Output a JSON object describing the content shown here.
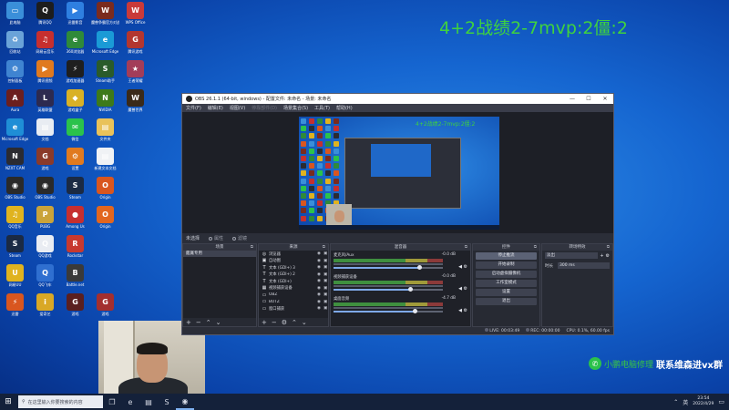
{
  "desktop_icons": [
    {
      "name": "此电脑",
      "icon": "computer-icon",
      "color": "#3a8fd9",
      "glyph": "▭"
    },
    {
      "name": "腾讯QQ",
      "icon": "qq-icon",
      "color": "#1d1d1d",
      "glyph": "Q"
    },
    {
      "name": "迅雷影音",
      "icon": "media-player-icon",
      "color": "#2e7fe0",
      "glyph": "▶"
    },
    {
      "name": "魔兽争霸官方对战平台",
      "icon": "warcraft-platform-icon",
      "color": "#7a2b1f",
      "glyph": "W"
    },
    {
      "name": "WPS Office",
      "icon": "wps-office-icon",
      "color": "#c93a3a",
      "glyph": "W"
    },
    {
      "name": "回收站",
      "icon": "recycle-bin-icon",
      "color": "#6aa3d8",
      "glyph": "♻"
    },
    {
      "name": "网易云音乐",
      "icon": "netease-music-icon",
      "color": "#c62f2f",
      "glyph": "♫"
    },
    {
      "name": "360浏览器",
      "icon": "browser-360-icon",
      "color": "#2f8a3a",
      "glyph": "e"
    },
    {
      "name": "Microsoft Edge",
      "icon": "edge-icon",
      "color": "#1a9ad6",
      "glyph": "e"
    },
    {
      "name": "腾讯游戏",
      "icon": "tencent-game-icon",
      "color": "#b3362f",
      "glyph": "G"
    },
    {
      "name": "控制面板",
      "icon": "control-panel-icon",
      "color": "#3f84d1",
      "glyph": "⚙"
    },
    {
      "name": "腾讯视频",
      "icon": "tencent-video-icon",
      "color": "#e07a1f",
      "glyph": "▶"
    },
    {
      "name": "游戏加速器",
      "icon": "accelerator-icon",
      "color": "#1f1f1f",
      "glyph": "⚡"
    },
    {
      "name": "Steam助手",
      "icon": "helper-icon",
      "color": "#2a5b2a",
      "glyph": "S"
    },
    {
      "name": "王者荣耀",
      "icon": "game-icon",
      "color": "#a33d59",
      "glyph": "★"
    },
    {
      "name": "Aura",
      "icon": "aura-icon",
      "color": "#6b1f1f",
      "glyph": "A"
    },
    {
      "name": "英雄联盟",
      "icon": "lol-icon",
      "color": "#2d2a4f",
      "glyph": "L"
    },
    {
      "name": "游戏盒子",
      "icon": "game-box-icon",
      "color": "#d9b126",
      "glyph": "◆"
    },
    {
      "name": "NVIDIA",
      "icon": "nvidia-icon",
      "color": "#3d7a1a",
      "glyph": "N"
    },
    {
      "name": "魔兽世界",
      "icon": "wow-icon",
      "color": "#3a2a1a",
      "glyph": "W"
    },
    {
      "name": "Microsoft Edge",
      "icon": "edge-icon",
      "color": "#1f8ed6",
      "glyph": "e"
    },
    {
      "name": "文档",
      "icon": "document-icon",
      "color": "#e8ecf2",
      "glyph": "▤"
    },
    {
      "name": "微信",
      "icon": "wechat-icon",
      "color": "#2bc24b",
      "glyph": "✉"
    },
    {
      "name": "文件夹",
      "icon": "folder-icon",
      "color": "#e9c25a",
      "glyph": "▤"
    },
    {
      "name": "",
      "icon": "blank-icon",
      "color": "transparent",
      "glyph": ""
    },
    {
      "name": "NZXT CAM",
      "icon": "nzxt-icon",
      "color": "#2b2b31",
      "glyph": "N"
    },
    {
      "name": "游戏",
      "icon": "game-icon",
      "color": "#8a3a2a",
      "glyph": "G"
    },
    {
      "name": "设置",
      "icon": "settings-icon",
      "color": "#e07a1f",
      "glyph": "⚙"
    },
    {
      "name": "新建文本文档",
      "icon": "text-file-icon",
      "color": "#f0f2f5",
      "glyph": "▤"
    },
    {
      "name": "",
      "icon": "blank-icon",
      "color": "transparent",
      "glyph": ""
    },
    {
      "name": "OBS Studio",
      "icon": "obs-icon",
      "color": "#2a2a2a",
      "glyph": "◉"
    },
    {
      "name": "OBS Studio",
      "icon": "obs-icon",
      "color": "#2a2a2a",
      "glyph": "◉"
    },
    {
      "name": "Steam",
      "icon": "steam-icon",
      "color": "#1b2a44",
      "glyph": "S"
    },
    {
      "name": "Origin",
      "icon": "origin-icon",
      "color": "#d9561f",
      "glyph": "O"
    },
    {
      "name": "",
      "icon": "blank-icon",
      "color": "transparent",
      "glyph": ""
    },
    {
      "name": "QQ音乐",
      "icon": "qq-music-icon",
      "color": "#e0b31f",
      "glyph": "♫"
    },
    {
      "name": "PUBG",
      "icon": "pubg-icon",
      "color": "#caa33a",
      "glyph": "P"
    },
    {
      "name": "Among Us",
      "icon": "among-us-icon",
      "color": "#c62f2f",
      "glyph": "●"
    },
    {
      "name": "Origin",
      "icon": "origin-icon",
      "color": "#e2661f",
      "glyph": "O"
    },
    {
      "name": "",
      "icon": "blank-icon",
      "color": "transparent",
      "glyph": ""
    },
    {
      "name": "Steam",
      "icon": "steam-icon",
      "color": "#1b2a44",
      "glyph": "S"
    },
    {
      "name": "QQ游戏",
      "icon": "qq-game-icon",
      "color": "#e9ecf2",
      "glyph": "Q"
    },
    {
      "name": "Rockstar",
      "icon": "rockstar-icon",
      "color": "#c7392f",
      "glyph": "R"
    },
    {
      "name": "",
      "icon": "blank-icon",
      "color": "transparent",
      "glyph": ""
    },
    {
      "name": "",
      "icon": "blank-icon",
      "color": "transparent",
      "glyph": ""
    },
    {
      "name": "网易UU",
      "icon": "uu-icon",
      "color": "#e0b31f",
      "glyph": "U"
    },
    {
      "name": "QQ飞车",
      "icon": "racing-game-icon",
      "color": "#2f6fd0",
      "glyph": "Q"
    },
    {
      "name": "Battle.net",
      "icon": "battlenet-icon",
      "color": "#3a3a3a",
      "glyph": "B"
    },
    {
      "name": "",
      "icon": "blank-icon",
      "color": "transparent",
      "glyph": ""
    },
    {
      "name": "",
      "icon": "blank-icon",
      "color": "transparent",
      "glyph": ""
    },
    {
      "name": "迅雷",
      "icon": "thunder-icon",
      "color": "#d9561f",
      "glyph": "⚡"
    },
    {
      "name": "爱奇艺",
      "icon": "iqiyi-icon",
      "color": "#d9a826",
      "glyph": "i"
    },
    {
      "name": "游戏",
      "icon": "game-icon",
      "color": "#5a1f1f",
      "glyph": "G"
    },
    {
      "name": "游戏",
      "icon": "game-icon",
      "color": "#a32f2f",
      "glyph": "G"
    },
    {
      "name": "",
      "icon": "blank-icon",
      "color": "transparent",
      "glyph": ""
    }
  ],
  "overlay": {
    "score_text": "4+2战绩2-7mvp:2僵:2",
    "contact_blur": "小鹏电脑修理",
    "contact_text": "联系维森进vx群"
  },
  "obs": {
    "title": "OBS 26.1.1 (64-bit, windows) - 配置文件: 未命名 - 场景: 未命名",
    "window_controls": {
      "minimize": "—",
      "maximize": "☐",
      "close": "✕"
    },
    "menu": [
      {
        "label": "文件(F)",
        "disabled": false
      },
      {
        "label": "编辑(E)",
        "disabled": false
      },
      {
        "label": "视图(V)",
        "disabled": false
      },
      {
        "label": "停靠部件(D)",
        "disabled": true
      },
      {
        "label": "场景集合(S)",
        "disabled": false
      },
      {
        "label": "工具(T)",
        "disabled": false
      },
      {
        "label": "帮助(H)",
        "disabled": false
      }
    ],
    "preview": {
      "score_text": "4+2战绩2-7mvp:2僵:2"
    },
    "scene_label": "未选择",
    "checkboxes": [
      "属性",
      "滤镜"
    ],
    "docks": {
      "scenes": {
        "title": "场景",
        "items": [
          "鑑賞专用"
        ]
      },
      "sources": {
        "title": "来源",
        "items": [
          {
            "name": "浏览器",
            "icon": "browser-source-icon",
            "glyph": "◎"
          },
          {
            "name": "自动图",
            "icon": "image-source-icon",
            "glyph": "▣"
          },
          {
            "name": "文本 (GDI+) 3",
            "icon": "text-source-icon",
            "glyph": "T"
          },
          {
            "name": "文本 (GDI+) 2",
            "icon": "text-source-icon",
            "glyph": "T"
          },
          {
            "name": "文本 (GDI+)",
            "icon": "text-source-icon",
            "glyph": "T"
          },
          {
            "name": "视频捕获设备",
            "icon": "camera-source-icon",
            "glyph": "▦"
          },
          {
            "name": "OBZ",
            "icon": "display-source-icon",
            "glyph": "▭"
          },
          {
            "name": "BOTZ",
            "icon": "display-source-icon",
            "glyph": "▭"
          },
          {
            "name": "窗口捕获",
            "icon": "window-source-icon",
            "glyph": "▭"
          }
        ]
      },
      "mixer": {
        "title": "混音器",
        "channels": [
          {
            "name": "麦克风/Aux",
            "db": "-0.0 dB",
            "level": 0.78
          },
          {
            "name": "视频捕获设备",
            "db": "-0.0 dB",
            "level": 0.7
          },
          {
            "name": "桌面音频",
            "db": "-4.7 dB",
            "level": 0.74
          }
        ]
      },
      "controls": {
        "title": "控件",
        "buttons": [
          {
            "label": "停止推流",
            "active": true
          },
          {
            "label": "开始录制",
            "active": false
          },
          {
            "label": "启动虚拟摄像机",
            "active": false
          },
          {
            "label": "工作室模式",
            "active": false
          },
          {
            "label": "设置",
            "active": false
          },
          {
            "label": "退出",
            "active": false
          }
        ]
      },
      "transitions": {
        "title": "转场特效",
        "selected": "淡出",
        "duration_label": "时长",
        "duration_value": "300 ms"
      }
    },
    "statusbar": {
      "live": "LIVE: 00:03:49",
      "rec": "REC: 00:00:00",
      "cpu": "CPU: 0.1%, 60.00 fps"
    }
  },
  "taskbar": {
    "start_icon": "⊞",
    "search_placeholder": "在这里输入你要搜索的内容",
    "apps": [
      {
        "name": "task-view",
        "icon": "task-view-icon",
        "glyph": "❐"
      },
      {
        "name": "edge",
        "icon": "edge-icon",
        "glyph": "e"
      },
      {
        "name": "explorer",
        "icon": "folder-icon",
        "glyph": "▤"
      },
      {
        "name": "steam",
        "icon": "steam-icon",
        "glyph": "S"
      },
      {
        "name": "obs",
        "icon": "obs-icon",
        "glyph": "◉"
      }
    ],
    "time": "23:54",
    "date": "2022/4/29"
  }
}
